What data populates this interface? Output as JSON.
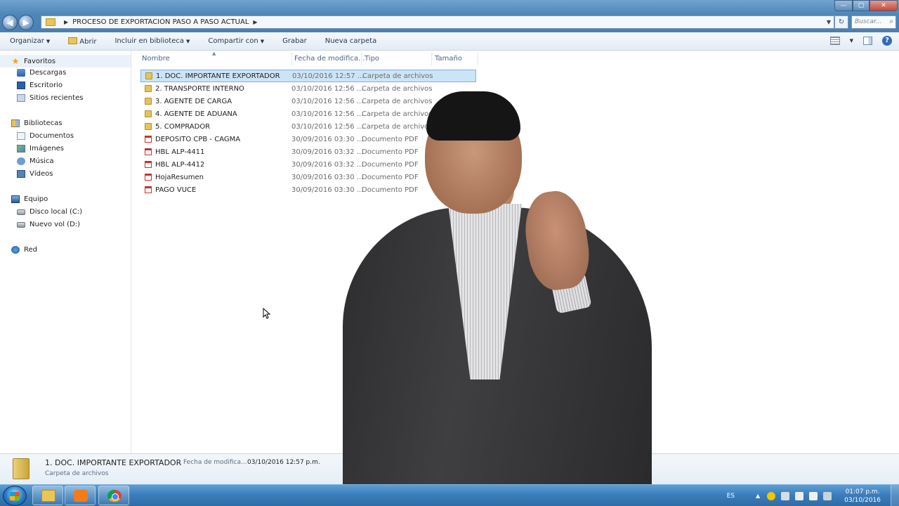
{
  "window": {
    "breadcrumb": "PROCESO DE EXPORTACION PASO A PASO ACTUAL",
    "search_placeholder": "Buscar...",
    "controls": {
      "minimize": "—",
      "maximize": "▢",
      "close": "✕"
    }
  },
  "toolbar": {
    "organize": "Organizar",
    "open": "Abrir",
    "include_library": "Incluir en biblioteca",
    "share": "Compartir con",
    "burn": "Grabar",
    "new_folder": "Nueva carpeta"
  },
  "nav": {
    "favorites": "Favoritos",
    "downloads": "Descargas",
    "desktop": "Escritorio",
    "recent": "Sitios recientes",
    "libraries": "Bibliotecas",
    "documents": "Documentos",
    "images": "Imágenes",
    "music": "Música",
    "videos": "Vídeos",
    "computer": "Equipo",
    "drive_c": "Disco local (C:)",
    "drive_d": "Nuevo vol (D:)",
    "network": "Red"
  },
  "columns": {
    "name": "Nombre",
    "date": "Fecha de modifica...",
    "type": "Tipo",
    "size": "Tamaño"
  },
  "files": [
    {
      "name": "1. DOC. IMPORTANTE  EXPORTADOR",
      "date": "03/10/2016 12:57 ...",
      "type": "Carpeta de archivos",
      "kind": "folder",
      "selected": true
    },
    {
      "name": "2. TRANSPORTE INTERNO",
      "date": "03/10/2016 12:56 ...",
      "type": "Carpeta de archivos",
      "kind": "folder"
    },
    {
      "name": "3. AGENTE DE CARGA",
      "date": "03/10/2016 12:56 ...",
      "type": "Carpeta de archivos",
      "kind": "folder"
    },
    {
      "name": "4. AGENTE DE ADUANA",
      "date": "03/10/2016 12:56 ...",
      "type": "Carpeta de archivos",
      "kind": "folder"
    },
    {
      "name": "5. COMPRADOR",
      "date": "03/10/2016 12:56 ...",
      "type": "Carpeta de archivos",
      "kind": "folder"
    },
    {
      "name": "DEPOSITO CPB - CAGMA",
      "date": "30/09/2016 03:30 ...",
      "type": "Documento PDF",
      "kind": "pdf"
    },
    {
      "name": "HBL ALP-4411",
      "date": "30/09/2016 03:32 ...",
      "type": "Documento PDF",
      "kind": "pdf"
    },
    {
      "name": "HBL ALP-4412",
      "date": "30/09/2016 03:32 ...",
      "type": "Documento PDF",
      "kind": "pdf"
    },
    {
      "name": "HojaResumen",
      "date": "30/09/2016 03:30 ...",
      "type": "Documento PDF",
      "kind": "pdf"
    },
    {
      "name": "PAGO VUCE",
      "date": "30/09/2016 03:30 ...",
      "type": "Documento PDF",
      "kind": "pdf"
    }
  ],
  "details": {
    "name": "1. DOC. IMPORTANTE  EXPORTADOR",
    "date_label": "Fecha de modifica...",
    "date_value": "03/10/2016 12:57 p.m.",
    "type": "Carpeta de archivos"
  },
  "taskbar": {
    "language": "ES",
    "time": "01:07 p.m.",
    "date": "03/10/2016"
  }
}
